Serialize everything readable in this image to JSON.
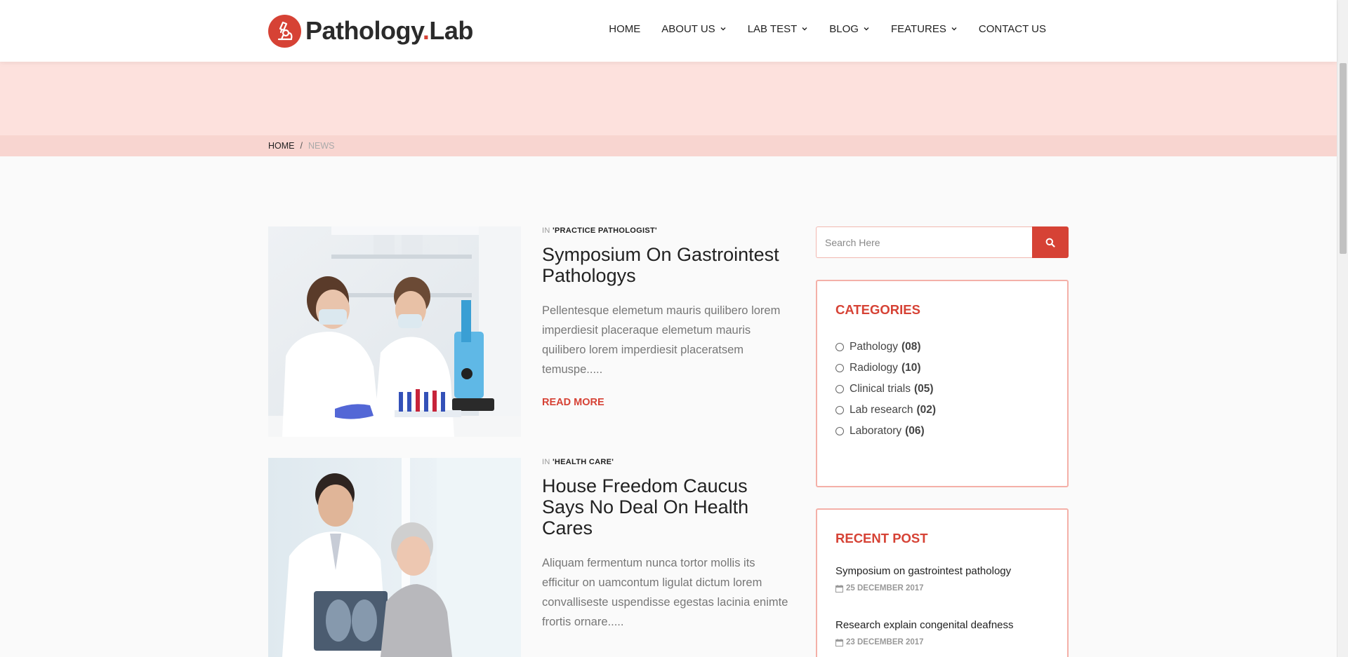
{
  "brand": {
    "name": "Pathology",
    "dot": ".",
    "suffix": "Lab",
    "accent": "#d64235"
  },
  "nav": [
    {
      "label": "HOME",
      "dropdown": false
    },
    {
      "label": "ABOUT US",
      "dropdown": true
    },
    {
      "label": "LAB TEST",
      "dropdown": true
    },
    {
      "label": "BLOG",
      "dropdown": true
    },
    {
      "label": "FEATURES",
      "dropdown": true
    },
    {
      "label": "CONTACT US",
      "dropdown": false
    }
  ],
  "breadcrumb": {
    "home": "HOME",
    "sep": "/",
    "current": "NEWS"
  },
  "posts": [
    {
      "cat_prefix": "IN ",
      "category": "'PRACTICE PATHOLOGIST'",
      "title": "Symposium On Gastrointest Pathologys",
      "excerpt": "Pellentesque elemetum mauris quilibero lorem imperdiesit placeraque elemetum mauris quilibero lorem imperdiesit placeratsem temuspe.....",
      "read_more": "READ MORE",
      "image": "lab-scientists-microscope"
    },
    {
      "cat_prefix": "IN ",
      "category": "'HEALTH CARE'",
      "title": "House Freedom Caucus Says No Deal On Health Cares",
      "excerpt": "Aliquam fermentum nunca tortor mollis its efficitur on uamcontum ligulat dictum lorem convalliseste uspendisse egestas lacinia enimte frortis ornare.....",
      "image": "doctor-xray-patient"
    }
  ],
  "search": {
    "placeholder": "Search Here",
    "icon": "search-icon"
  },
  "categories": {
    "title": "CATEGORIES",
    "items": [
      {
        "label": "Pathology",
        "count": "(08)"
      },
      {
        "label": "Radiology",
        "count": "(10)"
      },
      {
        "label": "Clinical trials",
        "count": "(05)"
      },
      {
        "label": "Lab research",
        "count": "(02)"
      },
      {
        "label": "Laboratory",
        "count": "(06)"
      }
    ]
  },
  "recent": {
    "title": "RECENT POST",
    "items": [
      {
        "title": "Symposium on gastrointest pathology",
        "date": "25 DECEMBER 2017"
      },
      {
        "title": "Research explain congenital deafness",
        "date": "23 DECEMBER 2017"
      }
    ]
  }
}
